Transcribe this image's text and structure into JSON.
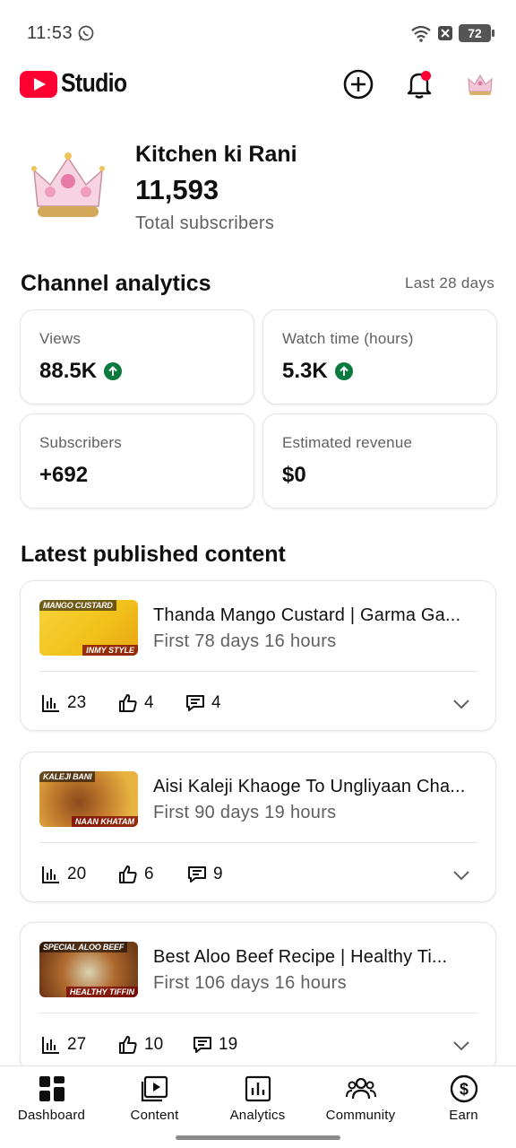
{
  "status_bar": {
    "time": "11:53",
    "battery": "72"
  },
  "header": {
    "brand": "Studio",
    "icons": [
      "youtube-logo",
      "create-icon",
      "notifications-icon",
      "account-avatar"
    ]
  },
  "channel": {
    "name": "Kitchen ki Rani",
    "subscribers": "11,593",
    "subscribers_label": "Total subscribers"
  },
  "analytics": {
    "title": "Channel analytics",
    "range": "Last 28 days",
    "cards": [
      {
        "label": "Views",
        "value": "88.5K",
        "trend": "up"
      },
      {
        "label": "Watch time (hours)",
        "value": "5.3K",
        "trend": "up"
      },
      {
        "label": "Subscribers",
        "value": "+692"
      },
      {
        "label": "Estimated revenue",
        "value": "$0"
      }
    ]
  },
  "latest": {
    "title": "Latest published content",
    "items": [
      {
        "title": "Thanda Mango Custard | Garma Ga...",
        "age": "First 78 days 16 hours",
        "views": "23",
        "likes": "4",
        "comments": "4",
        "thumb_top": "MANGO CUSTARD",
        "thumb_bottom": "INMY STYLE",
        "thumb_color": "#f2c21b"
      },
      {
        "title": "Aisi Kaleji Khaoge To Ungliyaan Cha...",
        "age": "First 90 days 19 hours",
        "views": "20",
        "likes": "6",
        "comments": "9",
        "thumb_top": "KALEJI BANI",
        "thumb_bottom": "NAAN KHATAM",
        "thumb_color": "#d9a23a"
      },
      {
        "title": "Best Aloo Beef Recipe | Healthy Ti...",
        "age": "First 106 days 16 hours",
        "views": "27",
        "likes": "10",
        "comments": "19",
        "thumb_top": "SPECIAL ALOO BEEF",
        "thumb_bottom": "HEALTHY TIFFIN",
        "thumb_color": "#b5651d"
      }
    ]
  },
  "nav": {
    "items": [
      {
        "label": "Dashboard",
        "icon": "dashboard-icon"
      },
      {
        "label": "Content",
        "icon": "content-icon"
      },
      {
        "label": "Analytics",
        "icon": "analytics-icon"
      },
      {
        "label": "Community",
        "icon": "community-icon"
      },
      {
        "label": "Earn",
        "icon": "earn-icon"
      }
    ]
  },
  "colors": {
    "accent_red": "#ff0033",
    "trend_green": "#0b7a3e",
    "text_secondary": "#606060"
  }
}
